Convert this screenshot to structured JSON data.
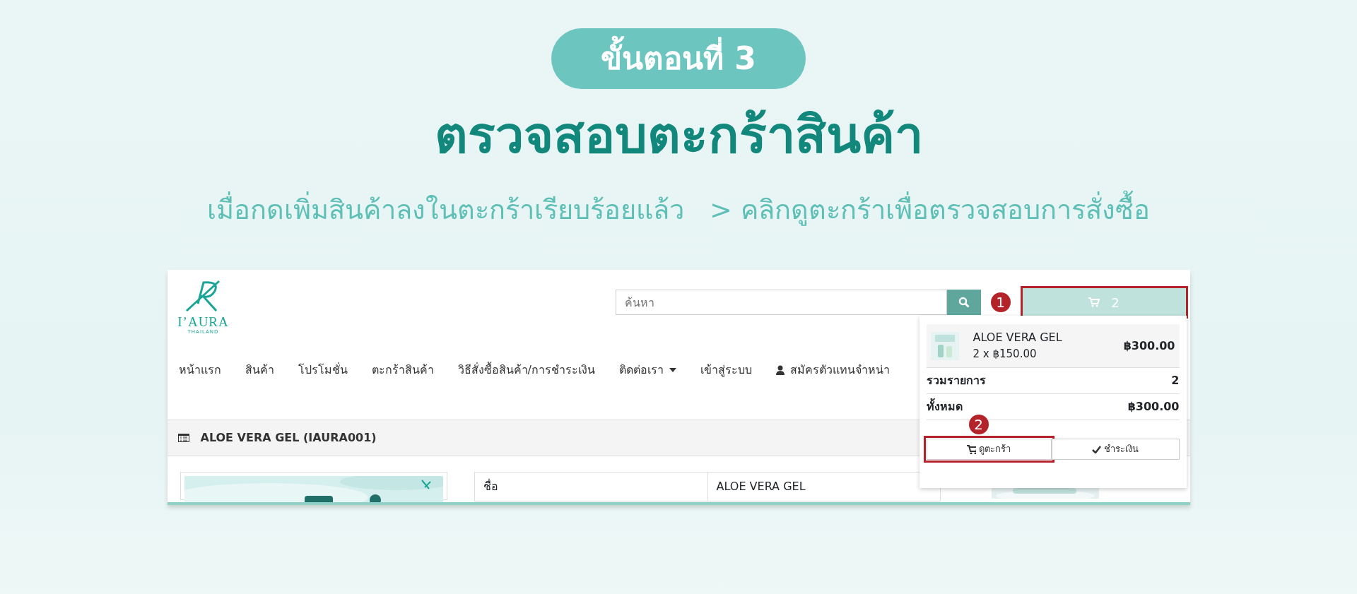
{
  "step_badge": "ขั้นตอนที่ 3",
  "title": "ตรวจสอบตะกร้าสินค้า",
  "subtitle": [
    "เมื่อกดเพิ่มสินค้าลงในตะกร้าเรียบร้อยแล้ว",
    "> คลิกดูตะกร้าเพื่อตรวจสอบการสั่งซื้อ"
  ],
  "screenshot": {
    "logo": {
      "brand": "I’AURA",
      "tagline": "THAILAND"
    },
    "search": {
      "placeholder": "ค้นหา"
    },
    "cart_button": {
      "count": "2",
      "highlighted": true,
      "marker": "1"
    },
    "nav": [
      {
        "label": "หน้าแรก",
        "kind": "link"
      },
      {
        "label": "สินค้า",
        "kind": "link"
      },
      {
        "label": "โปรโมชั่น",
        "kind": "link"
      },
      {
        "label": "ตะกร้าสินค้า",
        "kind": "link"
      },
      {
        "label": "วิธีสั่งซื้อสินค้า/การชำระเงิน",
        "kind": "link"
      },
      {
        "label": "ติดต่อเรา",
        "kind": "dropdown"
      },
      {
        "label": "เข้าสู่ระบบ",
        "kind": "link"
      },
      {
        "label": "สมัครตัวแทนจำหน่า",
        "kind": "user"
      }
    ],
    "product_header": "ALOE VERA GEL (IAURA001)",
    "detail_table": {
      "rows": [
        {
          "label": "ชื่อ",
          "value": "ALOE VERA GEL"
        }
      ]
    },
    "cart_dropdown": {
      "items": [
        {
          "name": "ALOE VERA GEL",
          "qty_price": "2 x ฿150.00",
          "total": "฿300.00"
        }
      ],
      "summary": [
        {
          "label": "รวมรายการ",
          "value": "2"
        },
        {
          "label": "ทั้งหมด",
          "value": "฿300.00"
        }
      ],
      "buttons": [
        {
          "label": "ดูตะกร้า",
          "kind": "cart",
          "highlighted": true,
          "marker": "2"
        },
        {
          "label": "ชำระเงิน",
          "kind": "check",
          "highlighted": false
        }
      ]
    }
  }
}
